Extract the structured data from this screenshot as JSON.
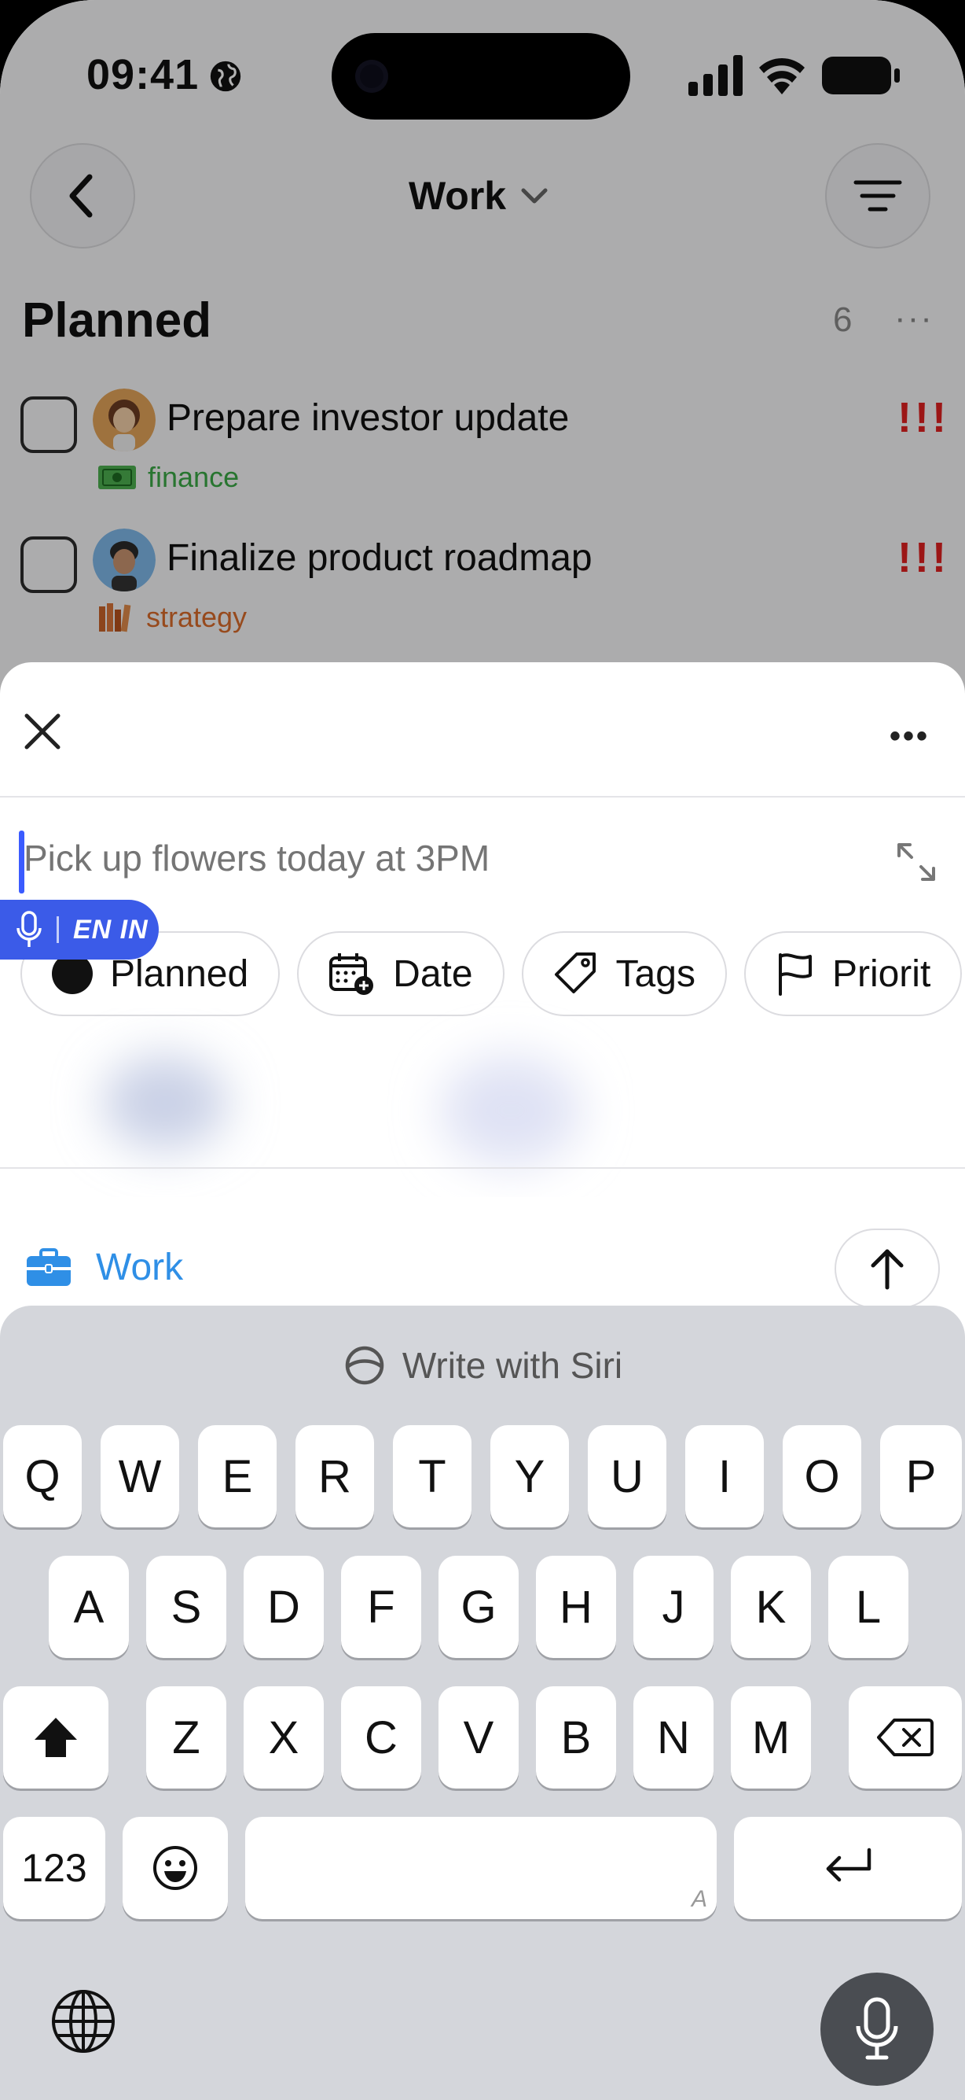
{
  "status_bar": {
    "time": "09:41"
  },
  "nav": {
    "title": "Work"
  },
  "section": {
    "title": "Planned",
    "count": "6",
    "more": "···"
  },
  "tasks": [
    {
      "title": "Prepare investor update",
      "tag": "finance",
      "tag_color": "#3aa845",
      "priority": "!!!",
      "checked": false
    },
    {
      "title": "Finalize product roadmap",
      "tag": "strategy",
      "tag_color": "#d96a2a",
      "priority": "!!!",
      "checked": false
    }
  ],
  "sheet": {
    "input": {
      "value": "",
      "placeholder": "Pick up flowers today at 3PM"
    },
    "dictation": {
      "language": "EN IN"
    },
    "chips": [
      {
        "label": "Planned",
        "icon": "circle-icon"
      },
      {
        "label": "Date",
        "icon": "calendar-plus-icon"
      },
      {
        "label": "Tags",
        "icon": "tag-icon"
      },
      {
        "label": "Priorit",
        "icon": "flag-icon"
      }
    ],
    "project": {
      "label": "Work",
      "icon": "briefcase-icon",
      "color": "#2f8fe6"
    }
  },
  "keyboard": {
    "siri_label": "Write with Siri",
    "rows": [
      [
        "Q",
        "W",
        "E",
        "R",
        "T",
        "Y",
        "U",
        "I",
        "O",
        "P"
      ],
      [
        "A",
        "S",
        "D",
        "F",
        "G",
        "H",
        "J",
        "K",
        "L"
      ],
      [
        "Z",
        "X",
        "C",
        "V",
        "B",
        "N",
        "M"
      ]
    ],
    "numbers_key": "123",
    "space_hint": "A"
  },
  "colors": {
    "accent": "#3b5be8",
    "priority": "#e02020",
    "link": "#2f8fe6"
  }
}
